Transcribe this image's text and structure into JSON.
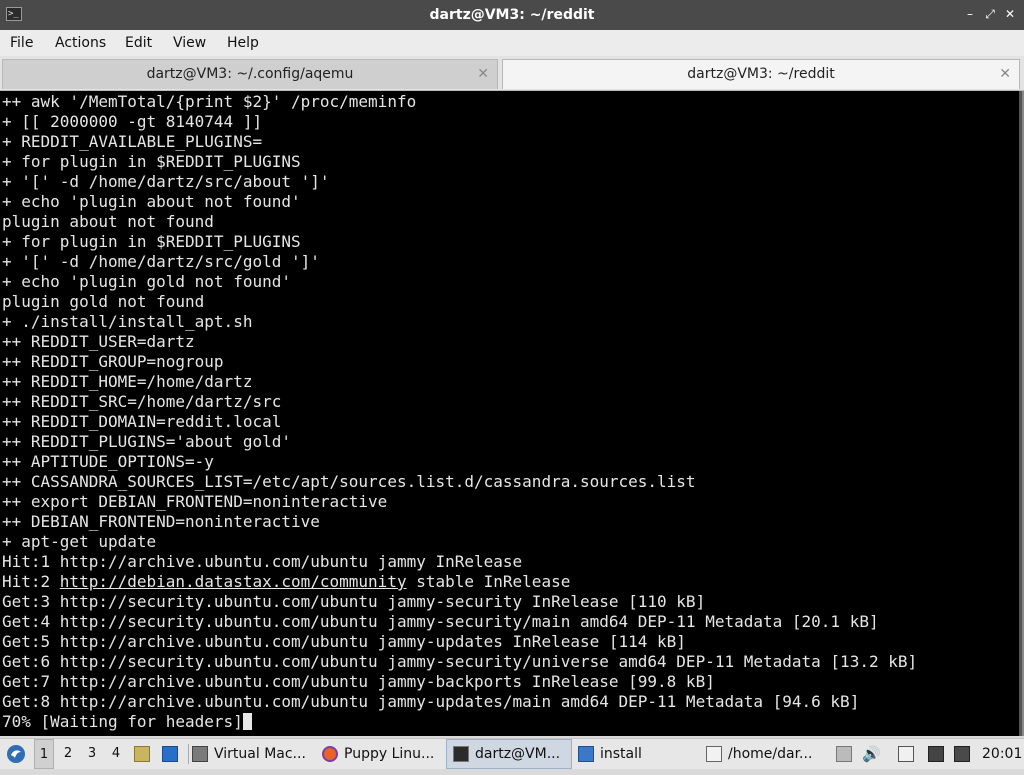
{
  "window": {
    "title": "dartz@VM3: ~/reddit",
    "controls": {
      "minimize": "–",
      "restore": "⤢",
      "close": "✕"
    }
  },
  "menu": [
    "File",
    "Actions",
    "Edit",
    "View",
    "Help"
  ],
  "tabs": [
    {
      "label": "dartz@VM3: ~/.config/aqemu",
      "active": false
    },
    {
      "label": "dartz@VM3: ~/reddit",
      "active": true
    }
  ],
  "terminal": {
    "lines": [
      "++ awk '/MemTotal/{print $2}' /proc/meminfo",
      "+ [[ 2000000 -gt 8140744 ]]",
      "+ REDDIT_AVAILABLE_PLUGINS=",
      "+ for plugin in $REDDIT_PLUGINS",
      "+ '[' -d /home/dartz/src/about ']'",
      "+ echo 'plugin about not found'",
      "plugin about not found",
      "+ for plugin in $REDDIT_PLUGINS",
      "+ '[' -d /home/dartz/src/gold ']'",
      "+ echo 'plugin gold not found'",
      "plugin gold not found",
      "+ ./install/install_apt.sh",
      "++ REDDIT_USER=dartz",
      "++ REDDIT_GROUP=nogroup",
      "++ REDDIT_HOME=/home/dartz",
      "++ REDDIT_SRC=/home/dartz/src",
      "++ REDDIT_DOMAIN=reddit.local",
      "++ REDDIT_PLUGINS='about gold'",
      "++ APTITUDE_OPTIONS=-y",
      "++ CASSANDRA_SOURCES_LIST=/etc/apt/sources.list.d/cassandra.sources.list",
      "++ export DEBIAN_FRONTEND=noninteractive",
      "++ DEBIAN_FRONTEND=noninteractive",
      "+ apt-get update",
      "Hit:1 http://archive.ubuntu.com/ubuntu jammy InRelease",
      "Hit:2 http://debian.datastax.com/community stable InRelease",
      "Get:3 http://security.ubuntu.com/ubuntu jammy-security InRelease [110 kB]",
      "Get:4 http://security.ubuntu.com/ubuntu jammy-security/main amd64 DEP-11 Metadata [20.1 kB]",
      "Get:5 http://archive.ubuntu.com/ubuntu jammy-updates InRelease [114 kB]",
      "Get:6 http://security.ubuntu.com/ubuntu jammy-security/universe amd64 DEP-11 Metadata [13.2 kB]",
      "Get:7 http://archive.ubuntu.com/ubuntu jammy-backports InRelease [99.8 kB]",
      "Get:8 http://archive.ubuntu.com/ubuntu jammy-updates/main amd64 DEP-11 Metadata [94.6 kB]",
      "70% [Waiting for headers]"
    ],
    "link_line_index": 24,
    "link_prefix": "Hit:2 ",
    "link_text": "http://debian.datastax.com/community",
    "link_suffix": " stable InRelease"
  },
  "taskbar": {
    "workspaces": [
      "1",
      "2",
      "3",
      "4"
    ],
    "current_workspace": "1",
    "tasks": [
      {
        "label": "Virtual Mac...",
        "icon": "virtualbox-icon"
      },
      {
        "label": "Puppy Linu...",
        "icon": "firefox-icon"
      },
      {
        "label": "dartz@VM...",
        "icon": "terminal-icon",
        "active": true
      },
      {
        "label": "install",
        "icon": "folder-icon"
      },
      {
        "label": "/home/dar...",
        "icon": "text-editor-icon"
      }
    ],
    "clock": "20:01"
  },
  "colors": {
    "titlebar": "#4a4a4a",
    "terminal_bg": "#000000",
    "terminal_fg": "#e6e6e6",
    "taskbar_bg": "#e7e7e7"
  }
}
